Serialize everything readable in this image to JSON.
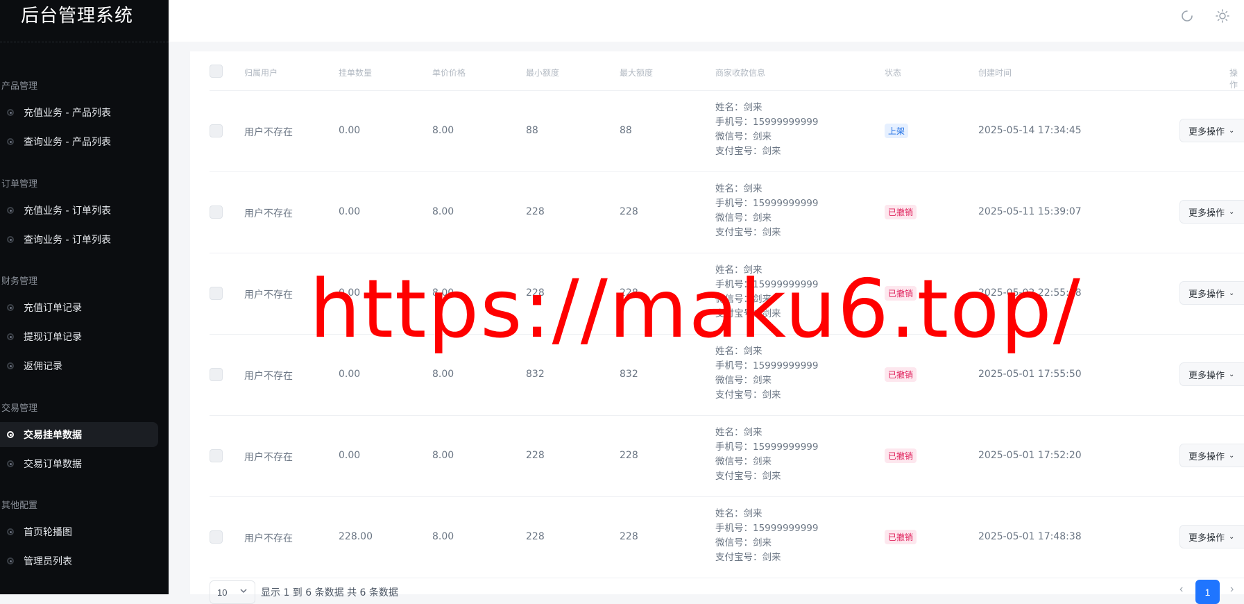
{
  "sidebar": {
    "brand": "后台管理系统",
    "groups": [
      {
        "title": "产品管理",
        "items": [
          "充值业务 - 产品列表",
          "查询业务 - 产品列表"
        ]
      },
      {
        "title": "订单管理",
        "items": [
          "充值业务 - 订单列表",
          "查询业务 - 订单列表"
        ]
      },
      {
        "title": "财务管理",
        "items": [
          "充值订单记录",
          "提现订单记录",
          "返佣记录"
        ]
      },
      {
        "title": "交易管理",
        "items": [
          "交易挂单数据",
          "交易订单数据"
        ]
      },
      {
        "title": "其他配置",
        "items": [
          "首页轮播图",
          "管理员列表"
        ]
      }
    ],
    "active_item": "交易挂单数据"
  },
  "header": {
    "icons": [
      "refresh-icon",
      "sun-icon"
    ]
  },
  "table": {
    "columns": [
      "归属用户",
      "挂单数量",
      "单价价格",
      "最小额度",
      "最大额度",
      "商家收款信息",
      "状态",
      "创建时间",
      "操作"
    ],
    "rows": [
      {
        "user": "用户不存在",
        "qty": "0.00",
        "price": "8.00",
        "min": "88",
        "max": "88",
        "info": [
          "姓名：剑来",
          "手机号：15999999999",
          "微信号：剑来",
          "支付宝号：剑来"
        ],
        "status": "上架",
        "status_color": "blue",
        "created": "2025-05-14 17:34:45",
        "action": "更多操作"
      },
      {
        "user": "用户不存在",
        "qty": "0.00",
        "price": "8.00",
        "min": "228",
        "max": "228",
        "info": [
          "姓名：剑来",
          "手机号：15999999999",
          "微信号：剑来",
          "支付宝号：剑来"
        ],
        "status": "已撤销",
        "status_color": "red",
        "created": "2025-05-11 15:39:07",
        "action": "更多操作"
      },
      {
        "user": "用户不存在",
        "qty": "0.00",
        "price": "8.00",
        "min": "228",
        "max": "228",
        "info": [
          "姓名：剑来",
          "手机号：15999999999",
          "微信号：剑来",
          "支付宝号：剑来"
        ],
        "status": "已撤销",
        "status_color": "red",
        "created": "2025-05-02 22:55:28",
        "action": "更多操作"
      },
      {
        "user": "用户不存在",
        "qty": "0.00",
        "price": "8.00",
        "min": "832",
        "max": "832",
        "info": [
          "姓名：剑来",
          "手机号：15999999999",
          "微信号：剑来",
          "支付宝号：剑来"
        ],
        "status": "已撤销",
        "status_color": "red",
        "created": "2025-05-01 17:55:50",
        "action": "更多操作"
      },
      {
        "user": "用户不存在",
        "qty": "0.00",
        "price": "8.00",
        "min": "228",
        "max": "228",
        "info": [
          "姓名：剑来",
          "手机号：15999999999",
          "微信号：剑来",
          "支付宝号：剑来"
        ],
        "status": "已撤销",
        "status_color": "red",
        "created": "2025-05-01 17:52:20",
        "action": "更多操作"
      },
      {
        "user": "用户不存在",
        "qty": "228.00",
        "price": "8.00",
        "min": "228",
        "max": "228",
        "info": [
          "姓名：剑来",
          "手机号：15999999999",
          "微信号：剑来",
          "支付宝号：剑来"
        ],
        "status": "已撤销",
        "status_color": "red",
        "created": "2025-05-01 17:48:38",
        "action": "更多操作"
      }
    ]
  },
  "pagination": {
    "page_size": "10",
    "info": "显示 1 到 6 条数据 共 6 条数据",
    "current_page": "1"
  },
  "watermark": "https://maku6.top/",
  "colors": {
    "sidebar_bg": "#0b0d10",
    "primary": "#1f75ff",
    "badge_blue": "#1f6fe5",
    "badge_red": "#e0245e",
    "watermark": "#ff0000"
  }
}
